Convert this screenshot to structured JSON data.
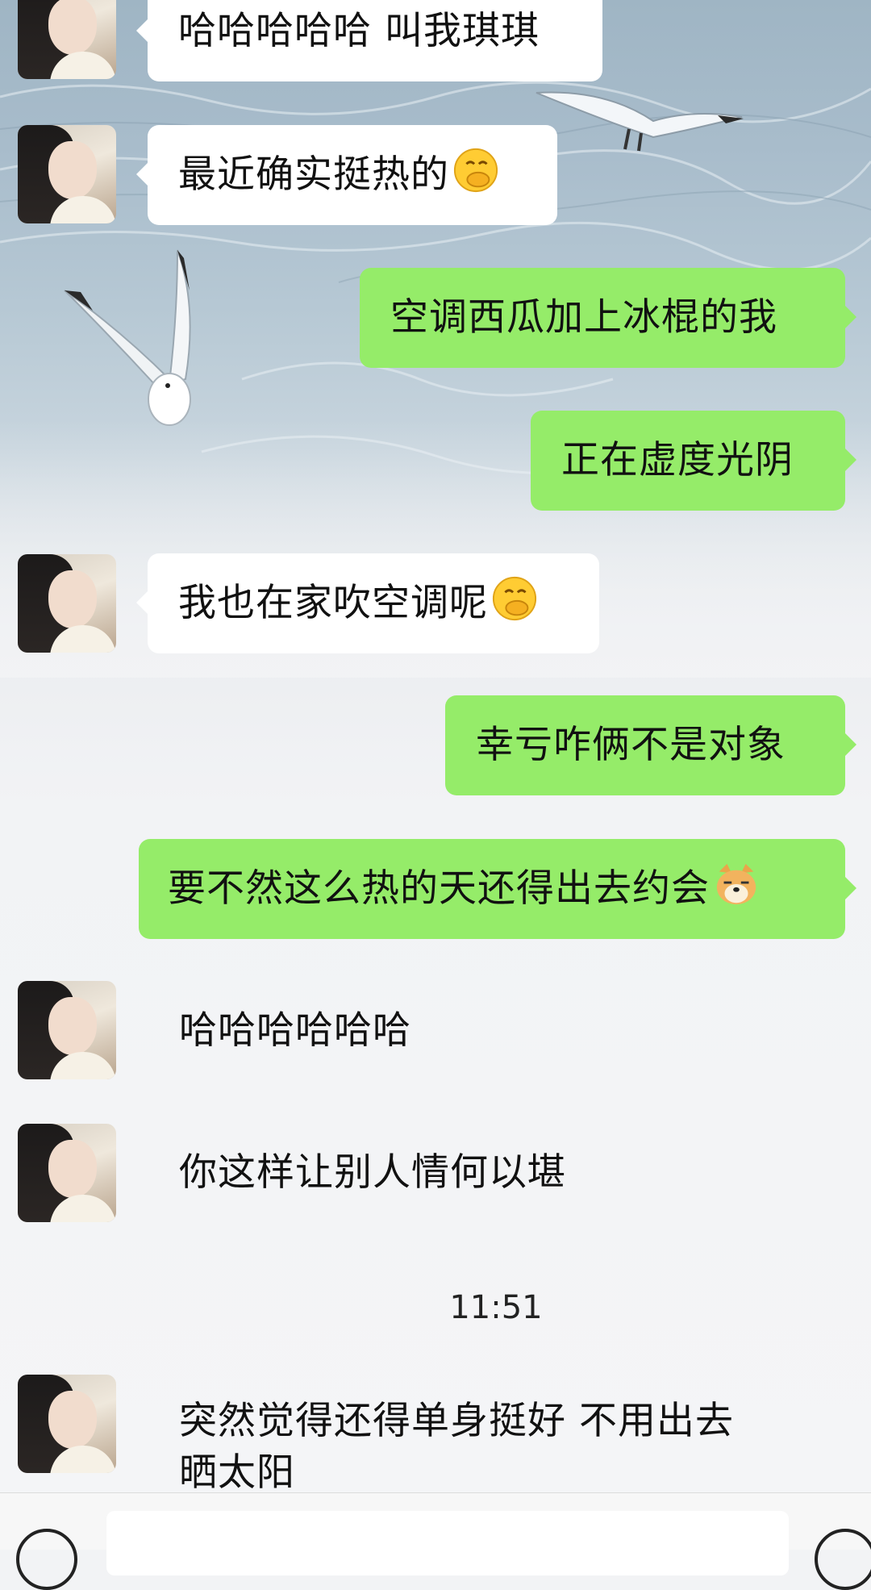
{
  "messages": [
    {
      "side": "in",
      "text": "哈哈哈哈哈 叫我琪琪"
    },
    {
      "side": "in",
      "text": "最近确实挺热的",
      "emoji": "face-with-hand-over-mouth-emoji"
    },
    {
      "side": "out",
      "text": "空调西瓜加上冰棍的我"
    },
    {
      "side": "out",
      "text": "正在虚度光阴"
    },
    {
      "side": "in",
      "text": "我也在家吹空调呢",
      "emoji": "face-with-hand-over-mouth-emoji"
    },
    {
      "side": "out",
      "text": "幸亏咋俩不是对象"
    },
    {
      "side": "out",
      "text": "要不然这么热的天还得出去约会",
      "emoji": "doge-emoji"
    },
    {
      "side": "in",
      "text": "哈哈哈哈哈哈"
    },
    {
      "side": "in",
      "text": "你这样让别人情何以堪"
    },
    {
      "side": "in",
      "text": "突然觉得还得单身挺好 不用出去",
      "text2": "晒太阳"
    }
  ],
  "timestamp": "11:51",
  "colors": {
    "outgoing_bubble": "#95ec69",
    "incoming_bubble": "#ffffff",
    "background": "#f2f3f5"
  },
  "icons": {
    "voice": "voice-icon",
    "emoji": "emoji-icon"
  }
}
